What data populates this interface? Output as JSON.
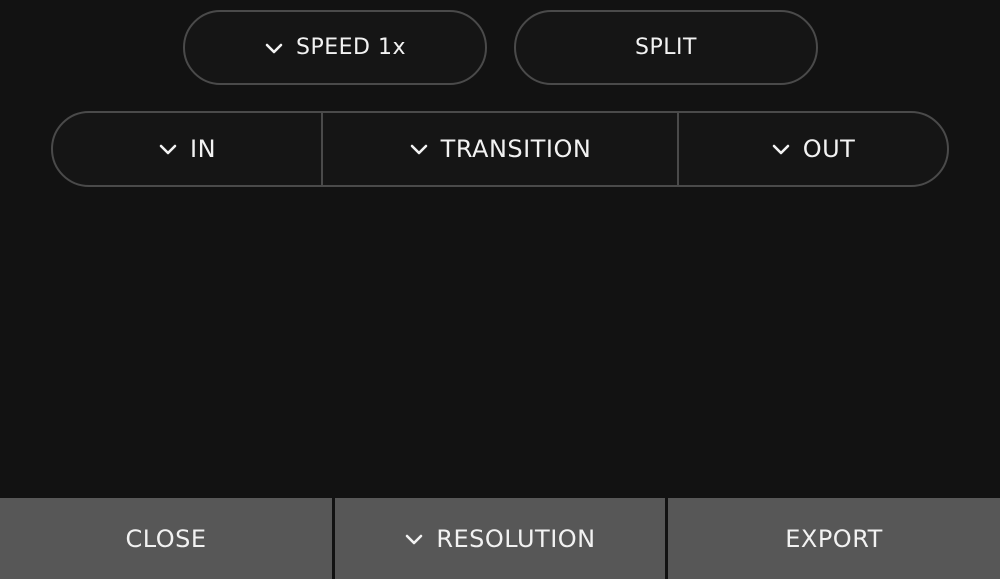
{
  "toolbar": {
    "speed_label": "SPEED 1x",
    "split_label": "SPLIT"
  },
  "segments": {
    "in_label": "IN",
    "transition_label": "TRANSITION",
    "out_label": "OUT"
  },
  "bottom": {
    "close_label": "CLOSE",
    "resolution_label": "RESOLUTION",
    "export_label": "EXPORT"
  },
  "icons": {
    "dropdown": "chevron-down-icon"
  },
  "colors": {
    "background": "#121212",
    "pill_border": "#4a4a4a",
    "bottom_button": "#575757",
    "text": "#f2f2f2"
  }
}
